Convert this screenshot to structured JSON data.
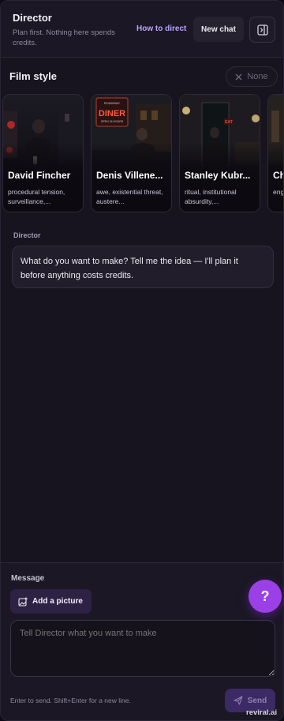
{
  "header": {
    "title": "Director",
    "subtitle": "Plan first. Nothing here spends credits.",
    "how_to_label": "How to direct",
    "new_chat_label": "New chat"
  },
  "film_style": {
    "title": "Film style",
    "none_label": "None",
    "cards": [
      {
        "name": "David Fincher",
        "desc": "procedural tension, surveillance,..."
      },
      {
        "name": "Denis Villene...",
        "desc": "awe, existential threat, austere..."
      },
      {
        "name": "Stanley Kubr...",
        "desc": "ritual, institutional absurdity,..."
      },
      {
        "name": "Ch",
        "desc": "eng sus"
      }
    ],
    "diner_sign": "DINER",
    "diner_top": "ROADWAY",
    "diner_bottom": "OPEN 24 HOURS",
    "eat_sign": "EAT"
  },
  "conversation": {
    "sender": "Director",
    "message": "What do you want to make? Tell me the idea — I'll plan it before anything costs credits."
  },
  "composer": {
    "label": "Message",
    "add_picture_label": "Add a picture",
    "placeholder": "Tell Director what you want to make",
    "hint": "Enter to send. Shift+Enter for a new line.",
    "send_label": "Send"
  },
  "help_label": "?",
  "watermark": "reviral.ai",
  "colors": {
    "panel_bg": "#17131f",
    "accent_purple": "#9b3fe6",
    "link_purple": "#b9a6ff",
    "send_bg": "#3b2a63"
  }
}
